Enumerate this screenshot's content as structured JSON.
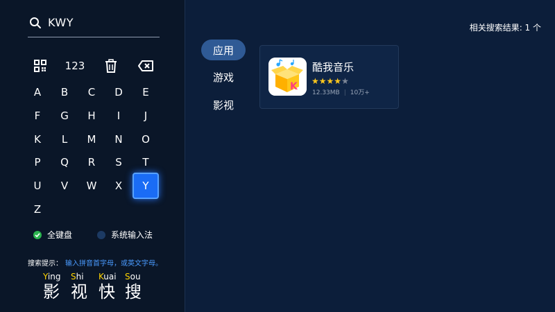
{
  "search": {
    "query": "KWY",
    "icon": "search-icon"
  },
  "keyboard": {
    "function_keys": [
      {
        "name": "qr-code-icon"
      },
      {
        "label": "123"
      },
      {
        "name": "trash-icon"
      },
      {
        "name": "backspace-icon"
      }
    ],
    "letters": [
      "A",
      "B",
      "C",
      "D",
      "E",
      "F",
      "G",
      "H",
      "I",
      "J",
      "K",
      "L",
      "M",
      "N",
      "O",
      "P",
      "Q",
      "R",
      "S",
      "T",
      "U",
      "V",
      "W",
      "X",
      "Y",
      "Z"
    ],
    "selected": "Y",
    "accent": "#1a6cf5"
  },
  "keyboard_options": {
    "full": "全键盘",
    "system": "系统输入法"
  },
  "hint": {
    "label": "搜索提示：",
    "text": "输入拼音首字母，或英文字母。"
  },
  "brand": [
    {
      "initial": "Y",
      "rest": "ing",
      "char": "影"
    },
    {
      "initial": "S",
      "rest": "hi",
      "char": "视"
    },
    {
      "initial": "K",
      "rest": "uai",
      "char": "快"
    },
    {
      "initial": "S",
      "rest": "ou",
      "char": "搜"
    }
  ],
  "tabs": [
    {
      "label": "应用",
      "active": true
    },
    {
      "label": "游戏",
      "active": false
    },
    {
      "label": "影视",
      "active": false
    }
  ],
  "results": {
    "summary": "相关搜索结果: 1 个"
  },
  "app": {
    "name": "酷我音乐",
    "rating_stars": 3.5,
    "size": "12.33MB",
    "downloads": "10万+"
  }
}
